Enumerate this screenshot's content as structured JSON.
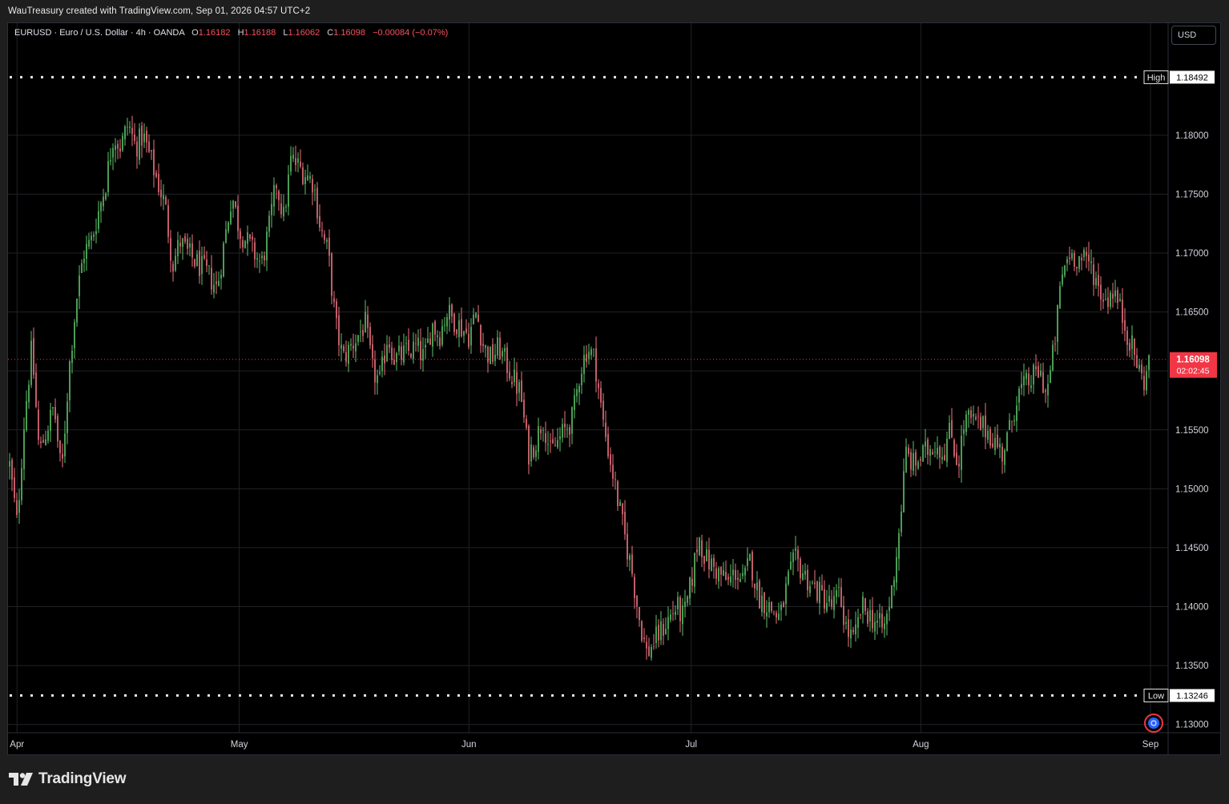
{
  "caption": "WauTreasury created with TradingView.com, Sep 01, 2026 04:57 UTC+2",
  "legend": {
    "symbol": "EURUSD · Euro / U.S. Dollar · 4h · OANDA",
    "open_label": "O",
    "open": "1.16182",
    "high_label": "H",
    "high": "1.16188",
    "low_label": "L",
    "low": "1.16062",
    "close_label": "C",
    "close": "1.16098",
    "change": "−0.00084 (−0.07%)"
  },
  "currency_button": "USD",
  "brand": "TradingView",
  "colors": {
    "up": "#26a69a",
    "up_candle": "#5ec46a",
    "down": "#ef7582",
    "price_line": "#f23645",
    "background": "#000000",
    "grid": "#1f2126"
  },
  "chart_data": {
    "type": "candlestick",
    "symbol": "EURUSD",
    "timeframe": "4h",
    "ylim": [
      1.1293,
      1.1895
    ],
    "y_ticks": [
      "1.18000",
      "1.17500",
      "1.17000",
      "1.16500",
      "1.16000",
      "1.15500",
      "1.15000",
      "1.14500",
      "1.14000",
      "1.13500",
      "1.13000"
    ],
    "x_ticks": [
      "Apr",
      "May",
      "Jun",
      "Jul",
      "Aug",
      "Sep"
    ],
    "high_marker": {
      "label": "High",
      "value": "1.18492"
    },
    "low_marker": {
      "label": "Low",
      "value": "1.13246"
    },
    "last_price": {
      "value": "1.16098",
      "countdown": "02:02:45"
    },
    "path": [
      [
        "Mar 31",
        1.152
      ],
      [
        "Apr 01",
        1.147
      ],
      [
        "Apr 02",
        1.156
      ],
      [
        "Apr 03",
        1.162
      ],
      [
        "Apr 04",
        1.153
      ],
      [
        "Apr 06",
        1.157
      ],
      [
        "Apr 07",
        1.151
      ],
      [
        "Apr 08",
        1.16
      ],
      [
        "Apr 09",
        1.166
      ],
      [
        "Apr 10",
        1.17
      ],
      [
        "Apr 11",
        1.171
      ],
      [
        "Apr 13",
        1.176
      ],
      [
        "Apr 14",
        1.18
      ],
      [
        "Apr 15",
        1.179
      ],
      [
        "Apr 16",
        1.181
      ],
      [
        "Apr 17",
        1.179
      ],
      [
        "Apr 18",
        1.18
      ],
      [
        "Apr 20",
        1.176
      ],
      [
        "Apr 21",
        1.174
      ],
      [
        "Apr 22",
        1.169
      ],
      [
        "Apr 23",
        1.171
      ],
      [
        "Apr 24",
        1.17
      ],
      [
        "Apr 27",
        1.168
      ],
      [
        "Apr 28",
        1.167
      ],
      [
        "Apr 29",
        1.171
      ],
      [
        "Apr 30",
        1.175
      ],
      [
        "May 01",
        1.172
      ],
      [
        "May 04",
        1.169
      ],
      [
        "May 05",
        1.172
      ],
      [
        "May 06",
        1.176
      ],
      [
        "May 07",
        1.173
      ],
      [
        "May 08",
        1.178
      ],
      [
        "May 11",
        1.176
      ],
      [
        "May 12",
        1.172
      ],
      [
        "May 13",
        1.17
      ],
      [
        "May 14",
        1.164
      ],
      [
        "May 15",
        1.161
      ],
      [
        "May 18",
        1.164
      ],
      [
        "May 19",
        1.16
      ],
      [
        "May 20",
        1.159
      ],
      [
        "May 21",
        1.163
      ],
      [
        "May 22",
        1.161
      ],
      [
        "May 25",
        1.162
      ],
      [
        "May 26",
        1.161
      ],
      [
        "May 27",
        1.164
      ],
      [
        "May 28",
        1.163
      ],
      [
        "May 29",
        1.165
      ],
      [
        "Jun 01",
        1.163
      ],
      [
        "Jun 02",
        1.165
      ],
      [
        "Jun 03",
        1.162
      ],
      [
        "Jun 04",
        1.161
      ],
      [
        "Jun 05",
        1.162
      ],
      [
        "Jun 08",
        1.158
      ],
      [
        "Jun 09",
        1.153
      ],
      [
        "Jun 10",
        1.154
      ],
      [
        "Jun 11",
        1.156
      ],
      [
        "Jun 12",
        1.153
      ],
      [
        "Jun 15",
        1.156
      ],
      [
        "Jun 16",
        1.16
      ],
      [
        "Jun 17",
        1.162
      ],
      [
        "Jun 18",
        1.161
      ],
      [
        "Jun 19",
        1.156
      ],
      [
        "Jun 22",
        1.146
      ],
      [
        "Jun 23",
        1.143
      ],
      [
        "Jun 24",
        1.139
      ],
      [
        "Jun 25",
        1.136
      ],
      [
        "Jun 26",
        1.137
      ],
      [
        "Jun 29",
        1.14
      ],
      [
        "Jun 30",
        1.139
      ],
      [
        "Jul 01",
        1.142
      ],
      [
        "Jul 02",
        1.146
      ],
      [
        "Jul 03",
        1.144
      ],
      [
        "Jul 06",
        1.142
      ],
      [
        "Jul 07",
        1.143
      ],
      [
        "Jul 08",
        1.142
      ],
      [
        "Jul 09",
        1.144
      ],
      [
        "Jul 10",
        1.141
      ],
      [
        "Jul 13",
        1.139
      ],
      [
        "Jul 14",
        1.142
      ],
      [
        "Jul 15",
        1.144
      ],
      [
        "Jul 16",
        1.143
      ],
      [
        "Jul 17",
        1.142
      ],
      [
        "Jul 20",
        1.14
      ],
      [
        "Jul 21",
        1.141
      ],
      [
        "Jul 22",
        1.138
      ],
      [
        "Jul 23",
        1.137
      ],
      [
        "Jul 24",
        1.14
      ],
      [
        "Jul 27",
        1.138
      ],
      [
        "Jul 28",
        1.141
      ],
      [
        "Jul 29",
        1.146
      ],
      [
        "Jul 30",
        1.153
      ],
      [
        "Jul 31",
        1.152
      ],
      [
        "Aug 03",
        1.154
      ],
      [
        "Aug 04",
        1.153
      ],
      [
        "Aug 05",
        1.155
      ],
      [
        "Aug 06",
        1.152
      ],
      [
        "Aug 07",
        1.156
      ],
      [
        "Aug 10",
        1.155
      ],
      [
        "Aug 11",
        1.154
      ],
      [
        "Aug 12",
        1.153
      ],
      [
        "Aug 13",
        1.155
      ],
      [
        "Aug 14",
        1.158
      ],
      [
        "Aug 17",
        1.16
      ],
      [
        "Aug 18",
        1.158
      ],
      [
        "Aug 19",
        1.162
      ],
      [
        "Aug 20",
        1.168
      ],
      [
        "Aug 21",
        1.17
      ],
      [
        "Aug 24",
        1.169
      ],
      [
        "Aug 25",
        1.167
      ],
      [
        "Aug 26",
        1.166
      ],
      [
        "Aug 27",
        1.167
      ],
      [
        "Aug 28",
        1.165
      ],
      [
        "Aug 31",
        1.159
      ],
      [
        "Sep 01",
        1.161
      ]
    ]
  }
}
